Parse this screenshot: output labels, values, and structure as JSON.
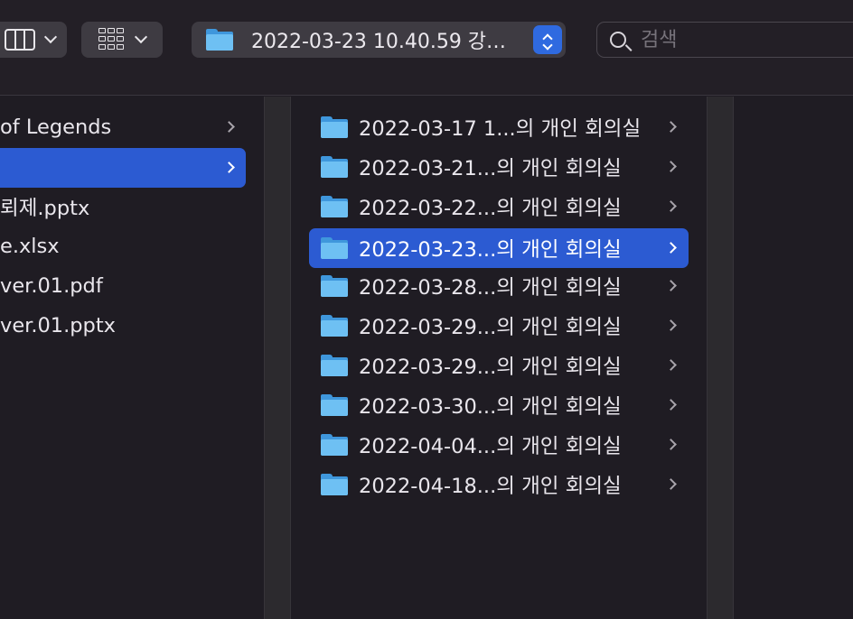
{
  "toolbar": {
    "path_label": "2022-03-23 10.40.59 강…",
    "search_placeholder": "검색"
  },
  "column1": {
    "items": [
      {
        "label": "of Legends",
        "selected": false
      },
      {
        "label": "",
        "selected": true
      },
      {
        "label": "뢰제.pptx",
        "selected": false
      },
      {
        "label": "e.xlsx",
        "selected": false
      },
      {
        "label": "ver.01.pdf",
        "selected": false
      },
      {
        "label": "ver.01.pptx",
        "selected": false
      }
    ]
  },
  "column2": {
    "items": [
      {
        "label": "2022-03-17 1...의 개인 회의실",
        "selected": false
      },
      {
        "label": "2022-03-21...의 개인 회의실",
        "selected": false
      },
      {
        "label": "2022-03-22...의 개인 회의실",
        "selected": false
      },
      {
        "label": "2022-03-23...의 개인 회의실",
        "selected": true
      },
      {
        "label": "2022-03-28...의 개인 회의실",
        "selected": false
      },
      {
        "label": "2022-03-29...의 개인 회의실",
        "selected": false
      },
      {
        "label": "2022-03-29...의 개인 회의실",
        "selected": false
      },
      {
        "label": "2022-03-30...의 개인 회의실",
        "selected": false
      },
      {
        "label": "2022-04-04...의 개인 회의실",
        "selected": false
      },
      {
        "label": "2022-04-18...의 개인 회의실",
        "selected": false
      }
    ]
  },
  "colors": {
    "selection": "#2c5bd2",
    "folder_front": "#6ec0f3",
    "folder_back": "#3f97dc",
    "stepper": "#2f6ae0"
  }
}
